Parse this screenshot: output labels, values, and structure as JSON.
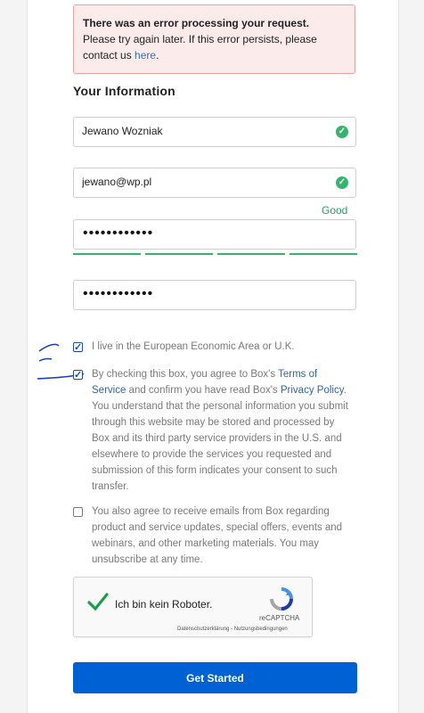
{
  "error": {
    "title": "There was an error processing your request.",
    "message": "Please try again later. If this error persists, please contact us ",
    "link": "here",
    "period": "."
  },
  "section_title": "Your Information",
  "fields": {
    "name_value": "Jewano Wozniak",
    "email_value": "jewano@wp.pl",
    "password_mask": "••••••••••••",
    "confirm_mask": "••••••••••••",
    "strength_label": "Good"
  },
  "checkboxes": {
    "eea": {
      "text": "I live in the European Economic Area or U.K.",
      "checked": true
    },
    "consent": {
      "checked": true,
      "part1": "By checking this box, you agree to Box's ",
      "tos": "Terms of Service",
      "part2": " and confirm you have read Box's ",
      "privacy": "Privacy Policy",
      "part3": ". You understand that the personal information you submit through this website may be stored and processed by Box and its third party service providers in the U.S. and elsewhere to provide the services you requested and submission of this form indicates your consent to such transfer."
    },
    "marketing": {
      "text": "You also agree to receive emails from Box regarding product and service updates, special offers, events and webinars, and other marketing materials. You may unsubscribe at any time.",
      "checked": false
    }
  },
  "recaptcha": {
    "label": "Ich bin kein Roboter.",
    "brand": "reCAPTCHA",
    "terms": "Datenschutzerklärung - Nutzungsbedingungen"
  },
  "submit_label": "Get Started",
  "colors": {
    "primary": "#0061d5",
    "success": "#35b46f",
    "error_bg": "#fcebeb",
    "link": "#2f64b0"
  }
}
